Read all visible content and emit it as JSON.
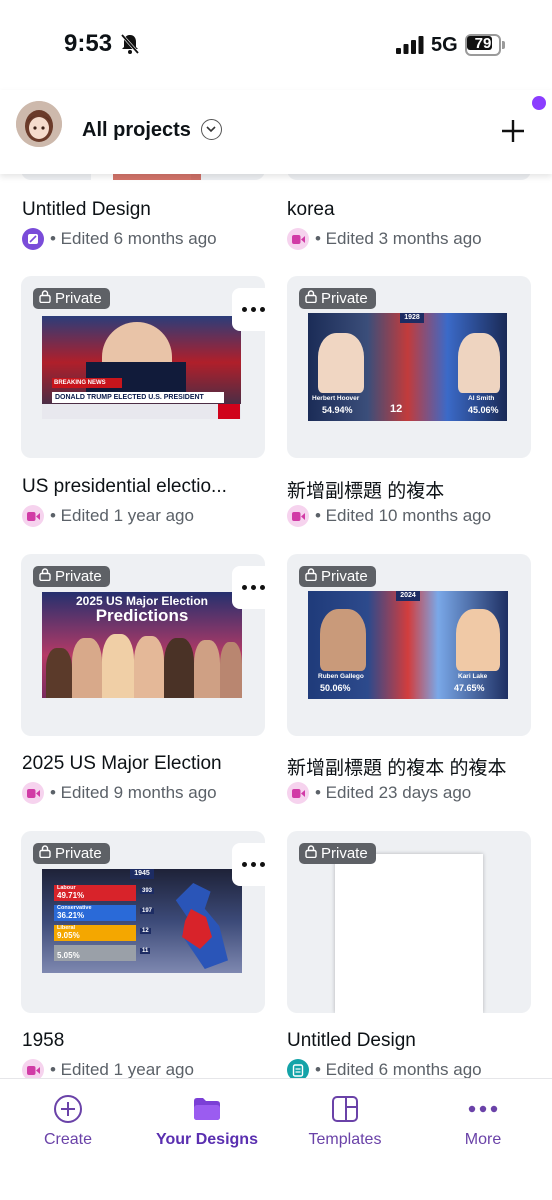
{
  "status": {
    "time": "9:53",
    "network": "5G",
    "battery": "79",
    "battery_level": 0.79
  },
  "header": {
    "title": "All projects",
    "avatar_icon": "user-avatar",
    "dropdown_icon": "chevron-down-icon",
    "add_icon": "plus-icon",
    "accent": "#8b3dff"
  },
  "badge_label": "Private",
  "more_icon": "more-dots-icon",
  "top_row": [
    {
      "title": "Untitled Design",
      "meta": "• Edited 6 months ago",
      "type_icon": "design-icon"
    },
    {
      "title": "korea",
      "meta": "• Edited 3 months ago",
      "type_icon": "video-icon"
    }
  ],
  "designs": [
    {
      "title": "US presidential electio...",
      "meta": "• Edited 1 year ago",
      "type_icon": "video-icon",
      "thumb": {
        "headline": "DONALD TRUMP ELECTED U.S. PRESIDENT",
        "tag": "BREAKING NEWS"
      }
    },
    {
      "title": "新增副標題 的複本",
      "meta": "• Edited 10 months ago",
      "type_icon": "video-icon",
      "thumb": {
        "year": "1928",
        "left_name": "Herbert Hoover",
        "left_pct": "54.94%",
        "right_name": "Al Smith",
        "right_pct": "45.06%",
        "ev": "12"
      }
    },
    {
      "title": "2025 US Major Election",
      "meta": "• Edited 9 months ago",
      "type_icon": "video-icon",
      "thumb": {
        "line1": "2025 US Major Election",
        "line2": "Predictions"
      }
    },
    {
      "title": "新增副標題 的複本 的複本",
      "meta": "• Edited 23 days ago",
      "type_icon": "video-icon",
      "thumb": {
        "year": "2024",
        "left_name": "Ruben Gallego",
        "left_pct": "50.06%",
        "right_name": "Kari Lake",
        "right_pct": "47.65%"
      }
    },
    {
      "title": "1958",
      "meta": "• Edited 1 year ago",
      "type_icon": "video-icon",
      "thumb": {
        "year": "1945",
        "rows": [
          {
            "party": "Labour",
            "pct": "49.71%",
            "seats": "393",
            "color": "#d8232a"
          },
          {
            "party": "Conservative",
            "pct": "36.21%",
            "seats": "197",
            "color": "#2a6ad8"
          },
          {
            "party": "Liberal",
            "pct": "9.05%",
            "seats": "12",
            "color": "#f4a700"
          },
          {
            "party": "",
            "pct": "5.05%",
            "seats": "11",
            "color": "#9aa0a8"
          }
        ]
      }
    },
    {
      "title": "Untitled Design",
      "meta": "• Edited 6 months ago",
      "type_icon": "doc-icon",
      "thumb": {}
    }
  ],
  "nav": [
    {
      "label": "Create",
      "icon": "plus-circle-icon"
    },
    {
      "label": "Your Designs",
      "icon": "folder-icon",
      "active": true
    },
    {
      "label": "Templates",
      "icon": "templates-icon"
    },
    {
      "label": "More",
      "icon": "more-dots-icon"
    }
  ]
}
